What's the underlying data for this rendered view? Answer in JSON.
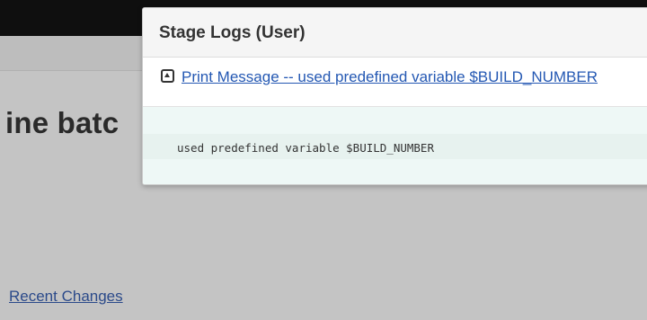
{
  "background": {
    "heading": "ine batc",
    "recent_changes_link": "Recent Changes"
  },
  "modal": {
    "title": "Stage Logs (User)",
    "step_link": "Print Message -- used predefined variable $BUILD_NUMBER",
    "collapse_icon": "collapse-icon",
    "log_line": "used predefined variable $BUILD_NUMBER"
  },
  "colors": {
    "link": "#2458b3",
    "log_background": "#eef8f6",
    "overlay": "#c4c4c4"
  }
}
